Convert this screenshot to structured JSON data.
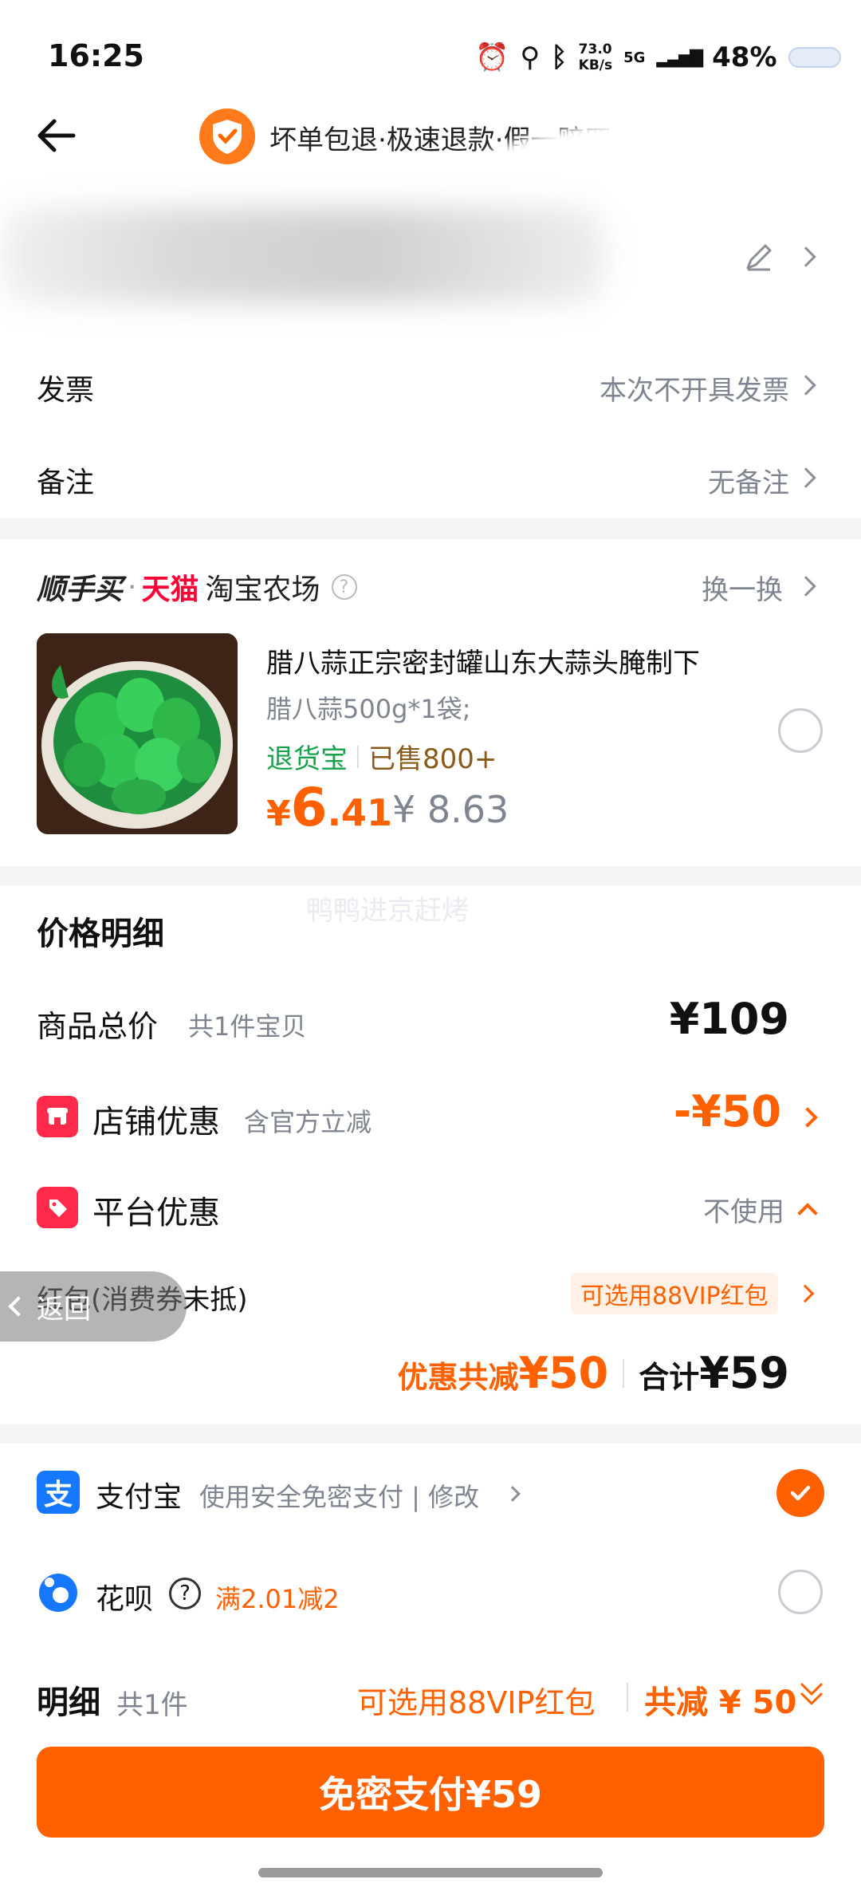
{
  "status_bar": {
    "time": "16:25",
    "net_speed_top": "73.0",
    "net_speed_bottom": "KB/s",
    "network": "5G",
    "battery": "48%"
  },
  "header": {
    "title": "坏单包退·极速退款·假一赔四"
  },
  "rows": {
    "invoice_label": "发票",
    "invoice_value": "本次不开具发票",
    "note_label": "备注",
    "note_value": "无备注"
  },
  "recommend": {
    "brand": "顺手买",
    "dot": "·",
    "tmall": "天猫",
    "farm": "淘宝农场",
    "swap": "换一换",
    "product_title": "腊八蒜正宗密封罐山东大蒜头腌制下",
    "product_spec": "腊八蒜500g*1袋;",
    "return_tag": "退货宝",
    "sold": "已售800+",
    "price_symbol": "¥",
    "price_int": "6",
    "price_dec": ".41",
    "orig_price": "¥ 8.63"
  },
  "price_detail": {
    "title": "价格明细",
    "watermark": "鸭鸭进京赶烤",
    "total_label": "商品总价",
    "total_count": "共1件宝贝",
    "total_value": "¥109",
    "shop_label": "店铺优惠",
    "shop_sub": "含官方立减",
    "shop_value": "-¥50",
    "platform_label": "平台优惠",
    "platform_value": "不使用",
    "redpacket_label": "红包(消费券未抵)",
    "redpacket_value": "可选用88VIP红包",
    "back_label": "返回",
    "discount_sum_label": "优惠共减",
    "discount_sum_value": "¥50",
    "sum_label": "合计",
    "sum_value": "¥59"
  },
  "payment": {
    "alipay_label": "支付宝",
    "alipay_sub": "使用安全免密支付 | 修改",
    "huabei_label": "花呗",
    "huabei_promo": "满2.01减2"
  },
  "bottom": {
    "detail_label": "明细",
    "detail_count": "共1件",
    "vip_text": "可选用88VIP红包",
    "sum_text": "共减 ¥ 50",
    "pay_button": "免密支付¥59"
  },
  "colors": {
    "accent": "#ff6000",
    "tmall_red": "#ff0036",
    "alipay_blue": "#1677ff",
    "green": "#16a34a"
  }
}
